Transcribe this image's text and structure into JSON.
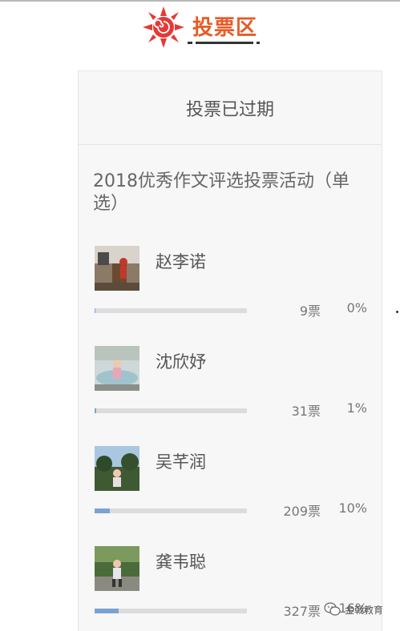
{
  "header": {
    "title": "投票区"
  },
  "status": {
    "text": "投票已过期"
  },
  "poll": {
    "title": "2018优秀作文评选投票活动（单选）"
  },
  "candidates": [
    {
      "name": "赵李诺",
      "votes": "9票",
      "percent": "0%",
      "fraction": 0.0
    },
    {
      "name": "沈欣妤",
      "votes": "31票",
      "percent": "1%",
      "fraction": 0.01
    },
    {
      "name": "吴芊润",
      "votes": "209票",
      "percent": "10%",
      "fraction": 0.1
    },
    {
      "name": "龚韦聪",
      "votes": "327票",
      "percent": "16%",
      "fraction": 0.16
    }
  ],
  "watermark": {
    "text": "金戟教育"
  },
  "colors": {
    "accent": "#e85a26",
    "bar_fill": "#7aa3d4",
    "bar_track": "#dcdcdc"
  }
}
